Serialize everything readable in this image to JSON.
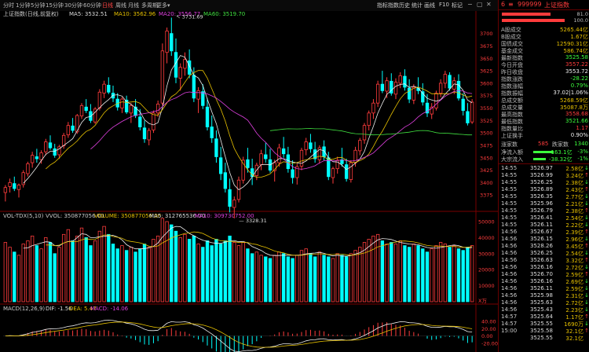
{
  "toolbar": {
    "timeframes": [
      "分时",
      "1分钟",
      "5分钟",
      "15分钟",
      "30分钟",
      "60分钟",
      "日线",
      "周线",
      "月线",
      "多周期",
      "更多"
    ],
    "active_timeframe": "日线",
    "menu": [
      "指标",
      "指数",
      "历史",
      "统计",
      "画线",
      "F10",
      "标记"
    ],
    "window_controls": [
      "−",
      "▢",
      "✕"
    ]
  },
  "main_legend": {
    "title": "上证指数(日线,前复权)",
    "ma5": "MA5: 3532.51",
    "ma10": "MA10: 3562.96",
    "ma20": "MA20: 3556.77",
    "ma60": "MA60: 3519.70"
  },
  "vol_legend": {
    "title": "VOL-TDX(5,10)",
    "vvol": "VVOL: 350877056.00",
    "volume": "VOLUME: 350877056.00",
    "ma5": "MA5: 312765536.00",
    "ma10": "MA10: 309730752.00"
  },
  "macd_legend": {
    "title": "MACD(12,26,9)",
    "dif": "DIF: -1.56",
    "dea": "DEA: 5.47",
    "macd": "MACD: -14.06"
  },
  "chart_data": [
    {
      "type": "candlestick",
      "name": "price",
      "ylim": [
        3350,
        3720
      ],
      "y_ticks": [
        3700,
        3675,
        3650,
        3625,
        3600,
        3575,
        3550,
        3525,
        3500,
        3475,
        3450,
        3425,
        3400,
        3375
      ],
      "annotations": [
        {
          "label": "3731.69",
          "bar": 37
        },
        {
          "label": "3328.31",
          "bar": 51
        }
      ],
      "ohlc": [
        [
          3380,
          3395,
          3362,
          3390
        ],
        [
          3392,
          3408,
          3380,
          3400
        ],
        [
          3398,
          3412,
          3383,
          3388
        ],
        [
          3386,
          3398,
          3370,
          3395
        ],
        [
          3396,
          3425,
          3390,
          3420
        ],
        [
          3418,
          3442,
          3412,
          3438
        ],
        [
          3440,
          3462,
          3430,
          3455
        ],
        [
          3452,
          3468,
          3440,
          3448
        ],
        [
          3446,
          3465,
          3438,
          3460
        ],
        [
          3462,
          3488,
          3455,
          3482
        ],
        [
          3480,
          3495,
          3466,
          3470
        ],
        [
          3468,
          3478,
          3450,
          3455
        ],
        [
          3456,
          3476,
          3448,
          3472
        ],
        [
          3474,
          3500,
          3468,
          3495
        ],
        [
          3496,
          3522,
          3490,
          3515
        ],
        [
          3514,
          3530,
          3500,
          3505
        ],
        [
          3502,
          3538,
          3498,
          3535
        ],
        [
          3534,
          3560,
          3528,
          3555
        ],
        [
          3552,
          3568,
          3540,
          3545
        ],
        [
          3543,
          3558,
          3520,
          3525
        ],
        [
          3522,
          3552,
          3518,
          3548
        ],
        [
          3550,
          3588,
          3545,
          3582
        ],
        [
          3580,
          3605,
          3570,
          3598
        ],
        [
          3596,
          3612,
          3578,
          3582
        ],
        [
          3580,
          3595,
          3562,
          3570
        ],
        [
          3568,
          3580,
          3545,
          3552
        ],
        [
          3550,
          3572,
          3540,
          3568
        ],
        [
          3566,
          3575,
          3538,
          3542
        ],
        [
          3540,
          3560,
          3520,
          3555
        ],
        [
          3552,
          3568,
          3530,
          3535
        ],
        [
          3532,
          3548,
          3505,
          3512
        ],
        [
          3510,
          3525,
          3480,
          3488
        ],
        [
          3486,
          3510,
          3475,
          3505
        ],
        [
          3506,
          3545,
          3500,
          3540
        ],
        [
          3540,
          3565,
          3532,
          3558
        ],
        [
          3560,
          3680,
          3555,
          3665
        ],
        [
          3662,
          3712,
          3640,
          3705
        ],
        [
          3700,
          3732,
          3655,
          3665
        ],
        [
          3662,
          3690,
          3600,
          3612
        ],
        [
          3610,
          3640,
          3585,
          3632
        ],
        [
          3630,
          3662,
          3615,
          3648
        ],
        [
          3645,
          3668,
          3610,
          3618
        ],
        [
          3616,
          3632,
          3562,
          3570
        ],
        [
          3568,
          3592,
          3540,
          3585
        ],
        [
          3583,
          3598,
          3548,
          3555
        ],
        [
          3552,
          3570,
          3505,
          3512
        ],
        [
          3512,
          3535,
          3480,
          3490
        ],
        [
          3488,
          3505,
          3440,
          3452
        ],
        [
          3450,
          3472,
          3405,
          3418
        ],
        [
          3420,
          3440,
          3380,
          3388
        ],
        [
          3386,
          3408,
          3340,
          3352
        ],
        [
          3350,
          3372,
          3328,
          3365
        ],
        [
          3366,
          3412,
          3360,
          3405
        ],
        [
          3405,
          3452,
          3398,
          3445
        ],
        [
          3446,
          3470,
          3420,
          3430
        ],
        [
          3428,
          3448,
          3395,
          3412
        ],
        [
          3414,
          3440,
          3405,
          3435
        ],
        [
          3436,
          3466,
          3425,
          3458
        ],
        [
          3456,
          3480,
          3440,
          3448
        ],
        [
          3446,
          3468,
          3420,
          3425
        ],
        [
          3424,
          3446,
          3402,
          3440
        ],
        [
          3440,
          3478,
          3432,
          3470
        ],
        [
          3468,
          3492,
          3450,
          3458
        ],
        [
          3456,
          3472,
          3420,
          3428
        ],
        [
          3426,
          3445,
          3398,
          3410
        ],
        [
          3410,
          3438,
          3396,
          3432
        ],
        [
          3433,
          3470,
          3425,
          3465
        ],
        [
          3466,
          3490,
          3455,
          3482
        ],
        [
          3480,
          3498,
          3460,
          3468
        ],
        [
          3466,
          3482,
          3440,
          3448
        ],
        [
          3446,
          3475,
          3438,
          3470
        ],
        [
          3472,
          3485,
          3445,
          3452
        ],
        [
          3450,
          3462,
          3405,
          3412
        ],
        [
          3410,
          3432,
          3398,
          3428
        ],
        [
          3428,
          3452,
          3418,
          3445
        ],
        [
          3446,
          3470,
          3432,
          3438
        ],
        [
          3436,
          3448,
          3402,
          3408
        ],
        [
          3406,
          3445,
          3400,
          3440
        ],
        [
          3440,
          3472,
          3432,
          3465
        ],
        [
          3464,
          3490,
          3455,
          3485
        ],
        [
          3486,
          3520,
          3478,
          3515
        ],
        [
          3515,
          3545,
          3505,
          3540
        ],
        [
          3540,
          3568,
          3528,
          3560
        ],
        [
          3560,
          3605,
          3552,
          3598
        ],
        [
          3598,
          3625,
          3580,
          3585
        ],
        [
          3584,
          3612,
          3570,
          3605
        ],
        [
          3604,
          3620,
          3575,
          3580
        ],
        [
          3578,
          3610,
          3568,
          3602
        ],
        [
          3600,
          3622,
          3590,
          3615
        ],
        [
          3614,
          3628,
          3585,
          3592
        ],
        [
          3590,
          3608,
          3560,
          3568
        ],
        [
          3566,
          3598,
          3558,
          3592
        ],
        [
          3590,
          3612,
          3578,
          3585
        ],
        [
          3583,
          3600,
          3555,
          3562
        ],
        [
          3560,
          3578,
          3532,
          3540
        ],
        [
          3538,
          3560,
          3528,
          3552
        ],
        [
          3550,
          3585,
          3545,
          3580
        ],
        [
          3580,
          3608,
          3572,
          3600
        ],
        [
          3600,
          3625,
          3590,
          3618
        ],
        [
          3616,
          3622,
          3585,
          3590
        ],
        [
          3588,
          3612,
          3578,
          3605
        ],
        [
          3604,
          3618,
          3565,
          3570
        ],
        [
          3568,
          3580,
          3535,
          3545
        ],
        [
          3543,
          3560,
          3515,
          3520
        ],
        [
          3522,
          3568,
          3518,
          3562
        ]
      ]
    },
    {
      "type": "bar",
      "name": "volume",
      "ylim": [
        0,
        50000
      ],
      "y_ticks": [
        50000,
        40000,
        30000,
        20000,
        10000
      ],
      "unit": "X万",
      "values": [
        37000,
        34000,
        31000,
        29000,
        36000,
        38000,
        41000,
        35000,
        33000,
        40000,
        37000,
        30000,
        34000,
        42000,
        45000,
        38000,
        41000,
        46000,
        40000,
        35000,
        38000,
        44000,
        47000,
        42000,
        36000,
        33000,
        35000,
        32000,
        34000,
        31000,
        33000,
        36000,
        34000,
        39000,
        41000,
        52000,
        50000,
        48000,
        44000,
        40000,
        42000,
        39000,
        41000,
        36000,
        34000,
        38000,
        35000,
        39000,
        36000,
        38000,
        41000,
        37000,
        35000,
        37000,
        33000,
        30000,
        31000,
        29000,
        28000,
        27000,
        29000,
        31000,
        30000,
        28000,
        27000,
        29000,
        32000,
        33000,
        30000,
        28000,
        31000,
        29000,
        28000,
        27000,
        30000,
        29000,
        28000,
        30000,
        32000,
        34000,
        37000,
        39000,
        41000,
        42000,
        38000,
        36000,
        37000,
        36000,
        38000,
        35000,
        34000,
        36000,
        35000,
        33000,
        31000,
        33000,
        35000,
        37000,
        36000,
        34000,
        35000,
        33000,
        32000,
        34000,
        35000
      ]
    },
    {
      "type": "bar",
      "name": "MACD",
      "ylim": [
        -40,
        60
      ],
      "y_ticks": [
        40,
        20,
        0,
        -20
      ],
      "dif_final": -1.56,
      "dea_final": 5.47,
      "macd_final": -14.06
    }
  ],
  "right_panel": {
    "code": "999999",
    "name": "上证指数",
    "header_num": "6",
    "bar1_val": "81.0",
    "bar2_val": "100.0",
    "rows": [
      {
        "label": "A股成交",
        "value": "5265.44亿",
        "color": "yellow"
      },
      {
        "label": "B股成交",
        "value": "1.67亿",
        "color": "yellow"
      },
      {
        "label": "国债成交",
        "value": "12590.31亿",
        "color": "yellow"
      },
      {
        "label": "基金成交",
        "value": "586.74亿",
        "color": "yellow"
      },
      {
        "label": "最新指数",
        "value": "3525.58",
        "color": "green"
      },
      {
        "label": "今日开盘",
        "value": "3557.22",
        "color": "red"
      },
      {
        "label": "昨日收盘",
        "value": "3553.72",
        "color": "white"
      },
      {
        "label": "指数涨跌",
        "value": "-28.22",
        "color": "green"
      },
      {
        "label": "指数涨幅",
        "value": "0.79%",
        "color": "green"
      },
      {
        "label": "指数振幅",
        "value": "37.02|1.06%",
        "color": "white"
      },
      {
        "label": "总成交额",
        "value": "5268.59亿",
        "color": "yellow"
      },
      {
        "label": "总成交量",
        "value": "35087.8万",
        "color": "yellow"
      },
      {
        "label": "最高指数",
        "value": "3558.68",
        "color": "red"
      },
      {
        "label": "最低指数",
        "value": "3521.66",
        "color": "green"
      },
      {
        "label": "指数量比",
        "value": "1.17",
        "color": "red"
      },
      {
        "label": "上证换手",
        "value": "0.90%",
        "color": "white"
      }
    ],
    "updown": {
      "up_label": "涨家数",
      "up_value": "585",
      "down_label": "跌家数",
      "down_value": "1340"
    },
    "flows": [
      {
        "label": "净流入额",
        "value": "-163.1亿",
        "pct": "-3%"
      },
      {
        "label": "大宗流入",
        "value": "-38.32亿",
        "pct": "-1%"
      }
    ],
    "ticks": [
      {
        "time": "14:55",
        "price": "3526.97",
        "vol": "2.58亿",
        "dir": "↓"
      },
      {
        "time": "14:55",
        "price": "3526.99",
        "vol": "3.24亿",
        "dir": "↑"
      },
      {
        "time": "14:55",
        "price": "3526.25",
        "vol": "2.38亿",
        "dir": "↓"
      },
      {
        "time": "14:55",
        "price": "3526.89",
        "vol": "2.43亿",
        "dir": "↑"
      },
      {
        "time": "14:55",
        "price": "3526.35",
        "vol": "2.77亿",
        "dir": "↓"
      },
      {
        "time": "14:55",
        "price": "3525.96",
        "vol": "2.21亿",
        "dir": "↓"
      },
      {
        "time": "14:55",
        "price": "3526.79",
        "vol": "2.38亿",
        "dir": "↑"
      },
      {
        "time": "14:55",
        "price": "3526.41",
        "vol": "2.54亿",
        "dir": "↓"
      },
      {
        "time": "14:55",
        "price": "3526.11",
        "vol": "2.22亿",
        "dir": "↓"
      },
      {
        "time": "14:56",
        "price": "3526.67",
        "vol": "2.39亿",
        "dir": "↑"
      },
      {
        "time": "14:56",
        "price": "3526.15",
        "vol": "2.96亿",
        "dir": "↓"
      },
      {
        "time": "14:56",
        "price": "3528.26",
        "vol": "3.45亿",
        "dir": "↑"
      },
      {
        "time": "14:56",
        "price": "3526.25",
        "vol": "2.54亿",
        "dir": "↓"
      },
      {
        "time": "14:56",
        "price": "3526.63",
        "vol": "3.32亿",
        "dir": "↑"
      },
      {
        "time": "14:56",
        "price": "3526.16",
        "vol": "2.72亿",
        "dir": "↓"
      },
      {
        "time": "14:56",
        "price": "3526.70",
        "vol": "2.59亿",
        "dir": "↑"
      },
      {
        "time": "14:56",
        "price": "3526.16",
        "vol": "2.69亿",
        "dir": "↓"
      },
      {
        "time": "14:56",
        "price": "3526.11",
        "vol": "2.59亿",
        "dir": "↓"
      },
      {
        "time": "14:56",
        "price": "3525.98",
        "vol": "2.31亿",
        "dir": "↓"
      },
      {
        "time": "14:56",
        "price": "3525.63",
        "vol": "2.72亿",
        "dir": "↓"
      },
      {
        "time": "14:56",
        "price": "3525.43",
        "vol": "2.23亿",
        "dir": "↓"
      },
      {
        "time": "14:57",
        "price": "3525.64",
        "vol": "1.17亿",
        "dir": "↑"
      },
      {
        "time": "14:57",
        "price": "3525.55",
        "vol": "1690万",
        "dir": "↓"
      },
      {
        "time": "15:00",
        "price": "3525.58",
        "vol": "32.1亿",
        "dir": "↑"
      },
      {
        "time": "",
        "price": "3525.55",
        "vol": "32.1亿",
        "dir": ""
      }
    ],
    "colors": {
      "up": "#ff3c3c",
      "down": "#00ffff",
      "green": "#3cff3c",
      "yellow": "#e6c000"
    }
  }
}
